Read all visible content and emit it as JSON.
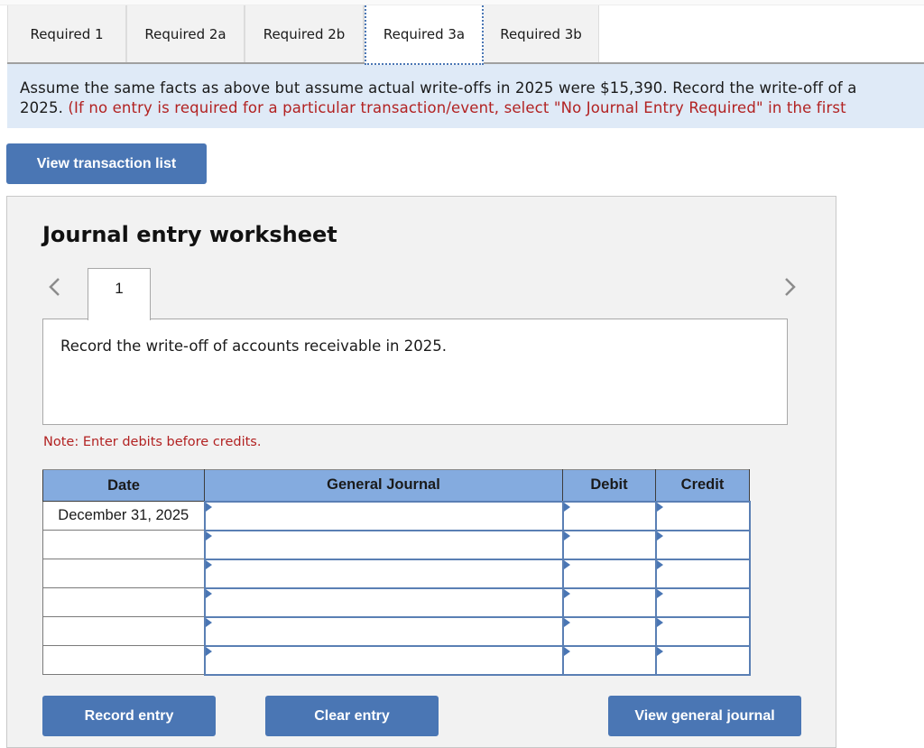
{
  "tabs": [
    {
      "label": "Required 1",
      "active": false
    },
    {
      "label": "Required 2a",
      "active": false
    },
    {
      "label": "Required 2b",
      "active": false
    },
    {
      "label": "Required 3a",
      "active": true
    },
    {
      "label": "Required 3b",
      "active": false
    }
  ],
  "instructions": {
    "line1": "Assume the same facts as above but assume actual write-offs in 2025 were $15,390. Record the write-off of a",
    "line2_black": "2025. ",
    "line2_red": "(If no entry is required for a particular transaction/event, select \"No Journal Entry Required\" in the first"
  },
  "buttons": {
    "view_transaction_list": "View transaction list",
    "record_entry": "Record entry",
    "clear_entry": "Clear entry",
    "view_general_journal": "View general journal"
  },
  "worksheet": {
    "title": "Journal entry worksheet",
    "entry_number": "1",
    "description": "Record the write-off of accounts receivable in 2025.",
    "note": "Note: Enter debits before credits.",
    "nav_left_icon": "chevron-left-icon",
    "nav_right_icon": "chevron-right-icon"
  },
  "journal_table": {
    "headers": {
      "date": "Date",
      "account": "General Journal",
      "debit": "Debit",
      "credit": "Credit"
    },
    "rows": [
      {
        "date": "December 31, 2025",
        "account": "",
        "debit": "",
        "credit": ""
      },
      {
        "date": "",
        "account": "",
        "debit": "",
        "credit": ""
      },
      {
        "date": "",
        "account": "",
        "debit": "",
        "credit": ""
      },
      {
        "date": "",
        "account": "",
        "debit": "",
        "credit": ""
      },
      {
        "date": "",
        "account": "",
        "debit": "",
        "credit": ""
      },
      {
        "date": "",
        "account": "",
        "debit": "",
        "credit": ""
      }
    ]
  },
  "colors": {
    "accent": "#4a76b4",
    "header_blue": "#84abdf",
    "instruction_bg": "#dfeaf7",
    "warning_red": "#b22222"
  }
}
